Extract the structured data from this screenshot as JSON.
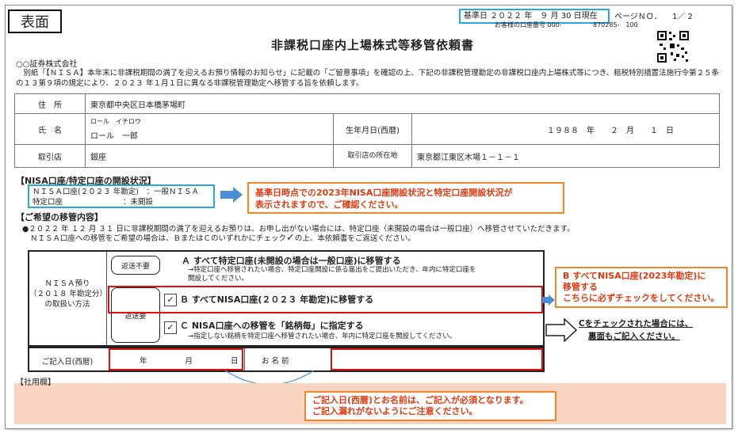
{
  "badge": "表面",
  "header": {
    "base_date": "基準日 ２０２２ 年　９ 月 30 日現在",
    "page_label": "ページＮＯ．",
    "page_value": "1／ 2",
    "account_label": "お客様の口座番号 000-",
    "account_value": "870285-　100"
  },
  "title": "非課税口座内上場株式等移管依頼書",
  "company": "○○証券株式会社",
  "intro": "　別紙「【ＮＩＳＡ】本年末に非課税期間の満了を迎えるお預り情報のお知らせ」に記載の「ご留意事項」を確認の上、下記の非課税管理勘定の非課税口座内上場株式等につき、租税特別措置法施行令第２５条の１３第９項の規定により、２０２３ 年１月１日に異なる非課税管理勘定へ移管する旨を依頼します。",
  "info": {
    "address_label": "住　所",
    "address_value": "東京都中央区日本橋茅場町",
    "name_label": "氏　名",
    "name_kana": "ロール　イチロウ",
    "name_value": "ロール　一郎",
    "birth_label": "生年月日(西暦)",
    "birth_value": "１９８８　年　　２　月　　１　日",
    "branch_label": "取引店",
    "branch_value": "銀座",
    "branch_addr_label": "取引店の所在地",
    "branch_addr_value": "東京都江東区木場１－１－１"
  },
  "nisa_status": {
    "section": "【NISA口座/特定口座の開設状況】",
    "nisa_label": "ＮＩＳＡ口座(２０２３ 年勘定)",
    "nisa_value": "：一般ＮＩＳＡ",
    "tokutei_label": "特定口座",
    "tokutei_value": "：未開設"
  },
  "ann1": {
    "line1": "基準日時点での2023年NISA口座開設状況と特定口座開設状況が",
    "line2": "表示されますので、ご確認ください。"
  },
  "request": {
    "section": "【ご希望の移管内容】",
    "note1": "●２０２２ 年 １２ 月 ３１ 日に非課税期間の満了を迎えるお預りは、お申し出がない場合には、特定口座（未開設の場合は一般口座）へ移管させていただきます。",
    "note2": "ＮＩＳＡ口座への移管をご希望の場合は、ＢまたはＣのいずれかにチェック",
    "note2_check": "✓",
    "note2_tail": "の上、本依頼書をご返送ください。",
    "left_label1": "ＮＩＳＡ預り",
    "left_label2": "（２０１８ 年勘定分）",
    "left_label3": "の取扱い方法",
    "no_return": "返送不要",
    "return_needed": "返送要",
    "optA_title": "Ａ すべて特定口座(未開設の場合は一般口座)に移管する",
    "optA_desc1": "→特定口座へ移管されたい場合、特定口座開設に係る届出をご提出いただき、年内に特定口座を",
    "optA_desc2": "開設してください。",
    "optB_check": "✓",
    "optB_title": "Ｂ すべてNISA口座(２０２３ 年勘定)に移管する",
    "optC_check": "✓",
    "optC_title": "Ｃ NISA口座への移管を「銘柄毎」に指定する",
    "optC_desc": "→指定しない銘柄を特定口座へ移管されたい場合、年内に特定口座を開設してください。",
    "date_label": "ご記入日(西暦)",
    "date_fields": "年　　　　月　　　　日",
    "name_label": "お 名 前"
  },
  "ann2": {
    "line1": "B すべてNISA口座(2023年勘定)に",
    "line2": "移管する",
    "line3": "こちらに必ずチェックをしてください。"
  },
  "ann3": {
    "line1": "Cをチェックされた場合には、",
    "line2": "裏面もご記入ください。"
  },
  "ann4": {
    "line1": "ご記入日(西暦)とお名前は、ご記入が必須となります。",
    "line2": "ご記入漏れがないようにご注意ください。"
  },
  "office_use": "【社用欄】",
  "colors": {
    "accent_blue": "#2aa7df",
    "annotation_orange": "#f0852a",
    "annotation_red": "#e03a10",
    "highlight_red": "#e01010",
    "office_band": "#f8d5c0"
  }
}
